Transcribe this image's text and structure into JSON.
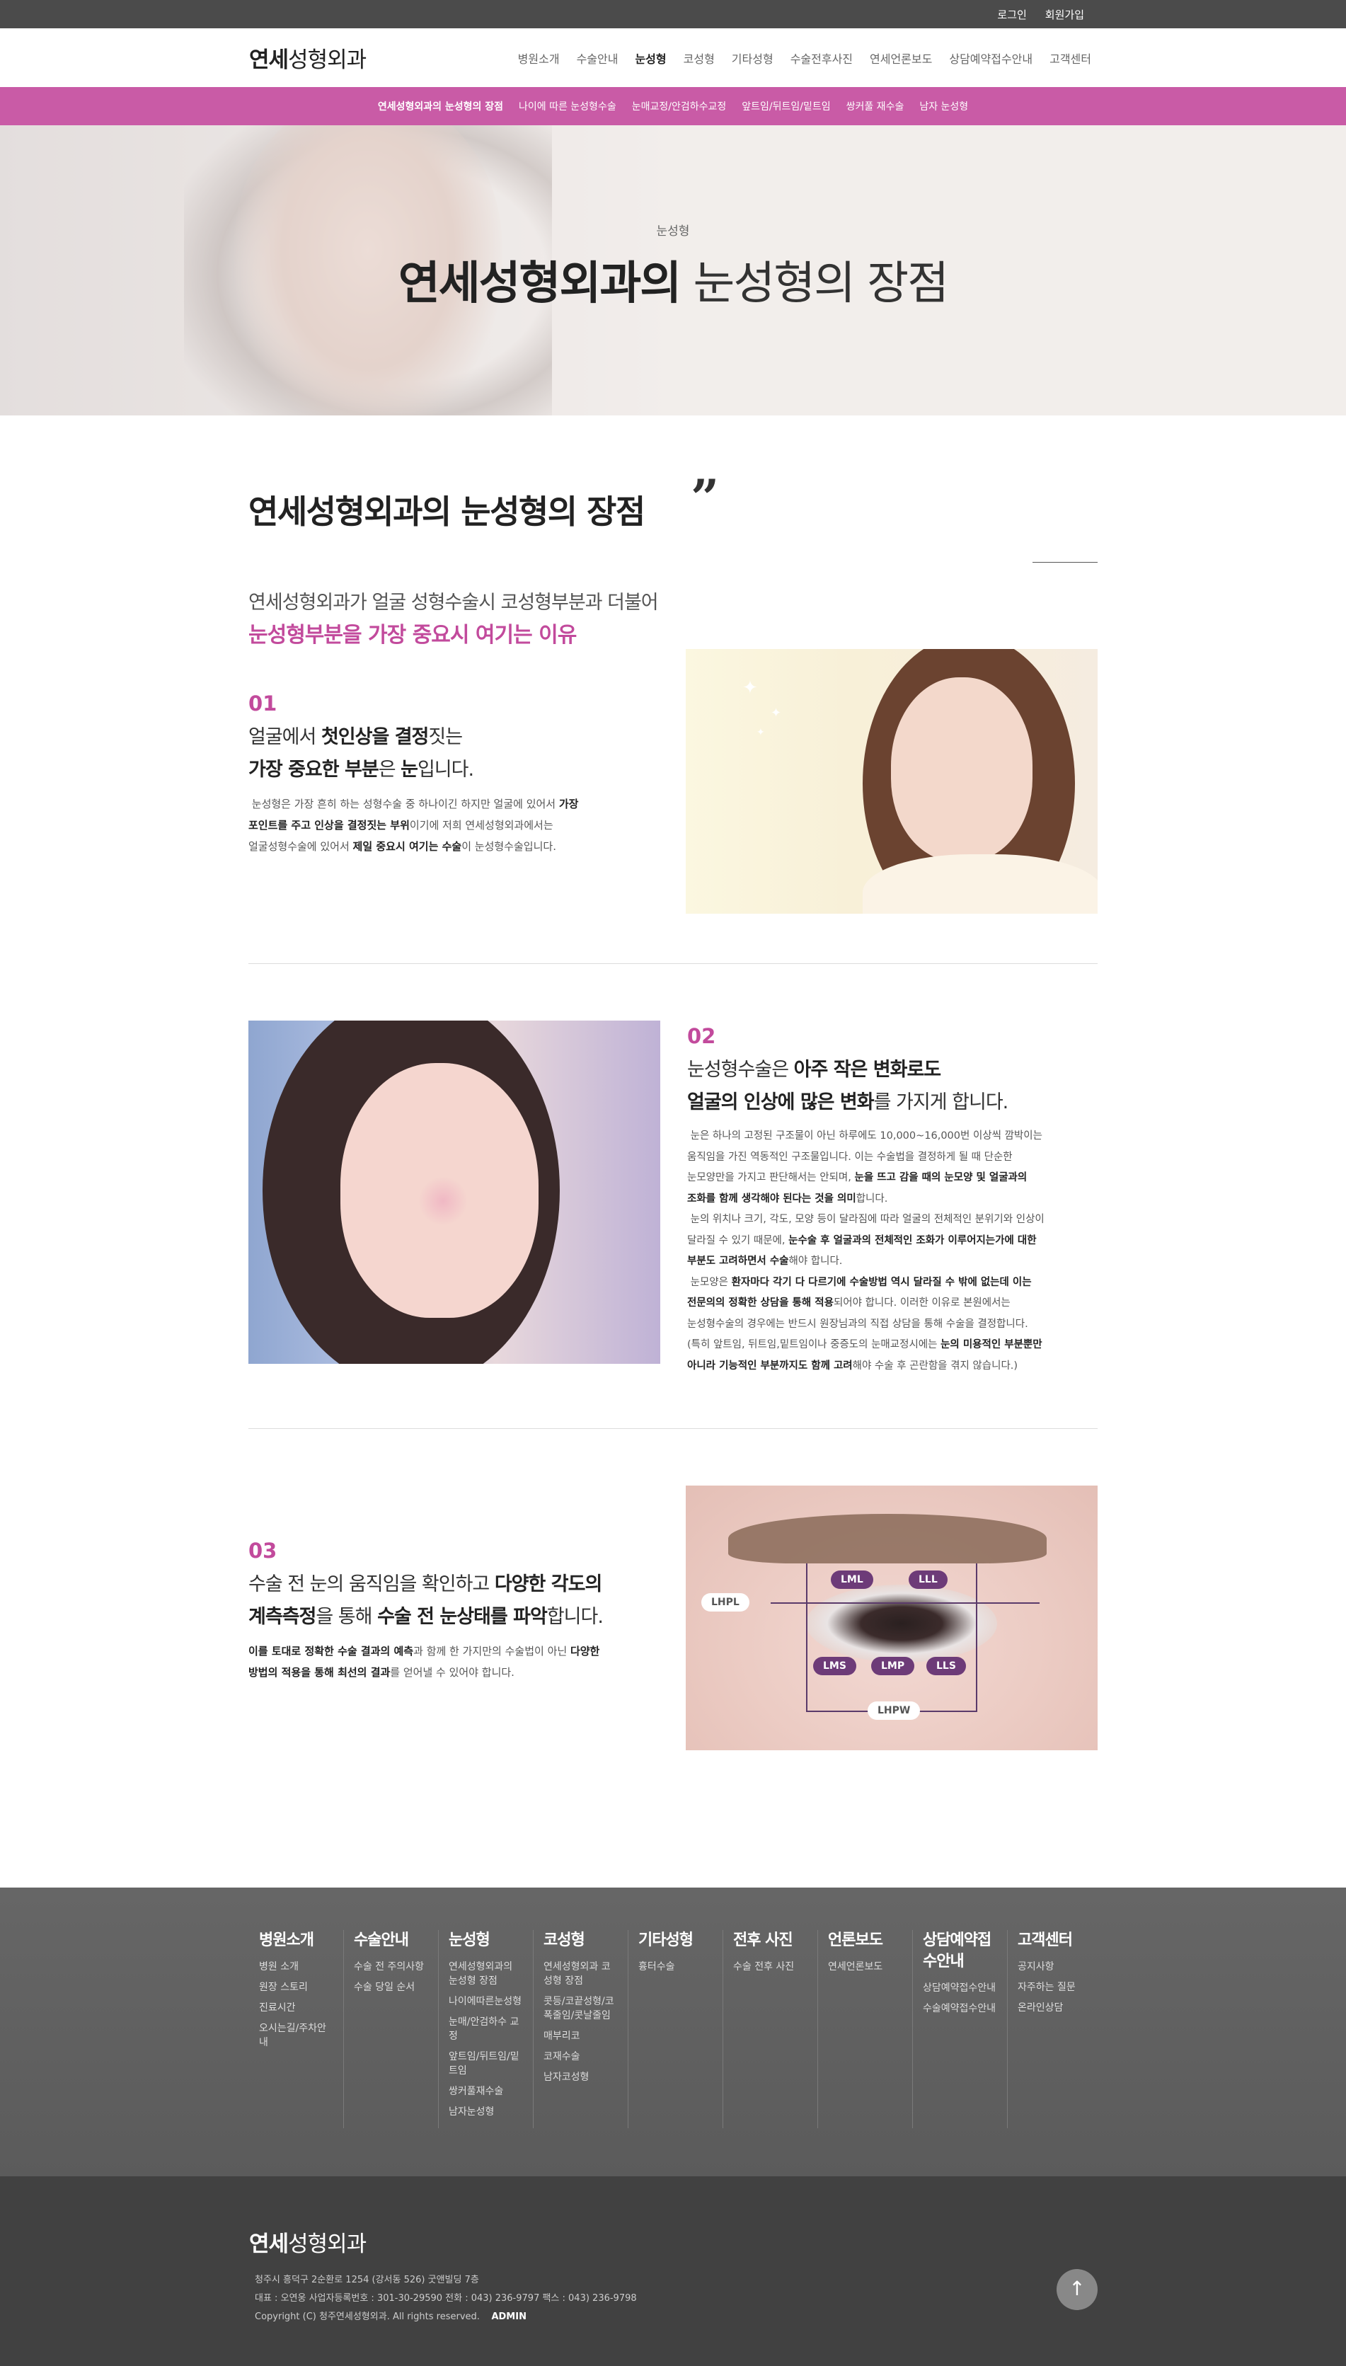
{
  "topbar": {
    "login": "로그인",
    "join": "회원가입"
  },
  "header": {
    "logo_bold": "연세",
    "logo_rest": "성형외과",
    "nav": [
      "병원소개",
      "수술안내",
      "눈성형",
      "코성형",
      "기타성형",
      "수술전후사진",
      "연세언론보도",
      "상담예약접수안내",
      "고객센터"
    ]
  },
  "subnav": [
    "연세성형외과의 눈성형의 장점",
    "나이에 따른 눈성형수술",
    "눈매교정/안검하수교정",
    "앞트임/뒤트임/밑트임",
    "쌍커풀 재수술",
    "남자 눈성형"
  ],
  "hero": {
    "sub": "눈성형",
    "title_bold": "연세성형외과의",
    "title_rest": " 눈성형의 장점"
  },
  "section": {
    "title": "연세성형외과의 눈성형의 장점",
    "quote": "”",
    "intro1": "연세성형외과가 얼굴 성형수술시 코성형부분과 더불어",
    "intro2": "눈성형부분을 가장 중요시 여기는 이유"
  },
  "items": [
    {
      "num": "01",
      "lead1a": "얼굴에서 ",
      "lead1b": "첫인상을 결정",
      "lead1c": "짓는",
      "lead2a": "가장 중요한 부분",
      "lead2b": "은 ",
      "lead2c": "눈",
      "lead2d": "입니다.",
      "desc1a": "눈성형은 가장 흔히 하는 성형수술 중 하나이긴 하지만 얼굴에 있어서 ",
      "desc1b": "가장",
      "desc2a": "포인트를 주고 인상을 결정짓는 부위",
      "desc2b": "이기에 저희 연세성형외과에서는",
      "desc3a": "얼굴성형수술에 있어서 ",
      "desc3b": "제일 중요시 여기는 수술",
      "desc3c": "이 눈성형수술입니다."
    },
    {
      "num": "02",
      "lead1a": "눈성형수술은 ",
      "lead1b": "아주 작은 변화로도",
      "lead2a": "얼굴의 인상에 많은 변화",
      "lead2b": "를 가지게 합니다.",
      "p1": "눈은 하나의 고정된 구조물이 아닌 하루에도 10,000~16,000번 이상씩 깜박이는",
      "p2": "움직임을 가진 역동적인 구조물입니다. 이는 수술법을 결정하게 될 때 단순한",
      "p3a": "눈모양만을 가지고 판단해서는 안되며, ",
      "p3b": "눈을 뜨고 감을 때의 눈모양 및 얼굴과의",
      "p4a": "조화를 함께 생각해야 된다는 것을 의미",
      "p4b": "합니다.",
      "p5": "눈의 위치나 크기, 각도, 모양 등이 달라짐에 따라 얼굴의 전체적인 분위기와 인상이",
      "p6a": "달라질 수 있기 때문에, ",
      "p6b": "눈수술 후 얼굴과의 전체적인 조화가 이루어지는가에 대한",
      "p7a": "부분도 고려하면서 수술",
      "p7b": "해야 합니다.",
      "p8a": "눈모양은 ",
      "p8b": "환자마다 각기 다 다르기에 수술방법 역시 달라질 수 밖에 없는데 이는",
      "p9a": "전문의의 정확한 상담을 통해 적용",
      "p9b": "되어야 합니다. 이러한 이유로 본원에서는",
      "p10": "눈성형수술의 경우에는 반드시 원장님과의 직접 상담을 통해 수술을 결정합니다.",
      "p11a": "(특히 앞트임, 뒤트임,밑트임이나 중증도의 눈매교정시에는 ",
      "p11b": "눈의 미용적인 부분뿐만",
      "p12a": "아니라 기능적인 부분까지도 함께 고려",
      "p12b": "해야 수술 후 곤란함을 겪지 않습니다.)"
    },
    {
      "num": "03",
      "lead1a": "수술 전 눈의 움직임을 확인하고 ",
      "lead1b": "다양한 각도의",
      "lead2a": "계측측정",
      "lead2b": "을 통해 ",
      "lead2c": "수술 전 눈상태를 파악",
      "lead2d": "합니다.",
      "desc1a": "이를 토대로 정확한 수술 결과의 예측",
      "desc1b": "과 함께 한 가지만의 수술법이 아닌 ",
      "desc1c": "다양한",
      "desc2a": "방법의 적용을 통해 최선의 결과",
      "desc2b": "를 얻어낼 수 있어야 합니다.",
      "labels": {
        "lml": "LML",
        "lll": "LLL",
        "lhpl": "LHPL",
        "lms": "LMS",
        "lmp": "LMP",
        "lls": "LLS",
        "lhpw": "LHPW"
      }
    }
  ],
  "footer_nav": [
    {
      "title": "병원소개",
      "links": [
        "병원 소개",
        "원장 스토리",
        "진료시간",
        "오시는길/주차안내"
      ]
    },
    {
      "title": "수술안내",
      "links": [
        "수술 전 주의사항",
        "수술 당일 순서"
      ]
    },
    {
      "title": "눈성형",
      "links": [
        "연세성형외과의 눈성형 장점",
        "나이에따른눈성형",
        "눈매/안검하수 교정",
        "앞트임/뒤트임/밑트임",
        "쌍커풀재수술",
        "남자눈성형"
      ]
    },
    {
      "title": "코성형",
      "links": [
        "연세성형외과 코성형 장점",
        "콧등/코끝성형/코폭줄임/콧날줄임",
        "매부리코",
        "코재수술",
        "남자코성형"
      ]
    },
    {
      "title": "기타성형",
      "links": [
        "흉터수술"
      ]
    },
    {
      "title": "전후 사진",
      "links": [
        "수술 전후 사진"
      ]
    },
    {
      "title": "언론보도",
      "links": [
        "연세언론보도"
      ]
    },
    {
      "title": "상담예약접수안내",
      "links": [
        "상담예약접수안내",
        "수술예약접수안내"
      ]
    },
    {
      "title": "고객센터",
      "links": [
        "공지사항",
        "자주하는 질문",
        "온라인상담"
      ]
    }
  ],
  "footer": {
    "logo_bold": "연세",
    "logo_rest": "성형외과",
    "address": "청주시 흥덕구 2순환로 1254 (강서동 526) 굿앤빌딩 7층",
    "info": "대표 : 오연웅     사업자등록번호 : 301-30-29590     전화 : 043) 236-9797     팩스 : 043) 236-9798",
    "copyright": "Copyright (C) 청주연세성형외과. All rights reserved.",
    "admin": "ADMIN",
    "top_icon": "↑"
  }
}
